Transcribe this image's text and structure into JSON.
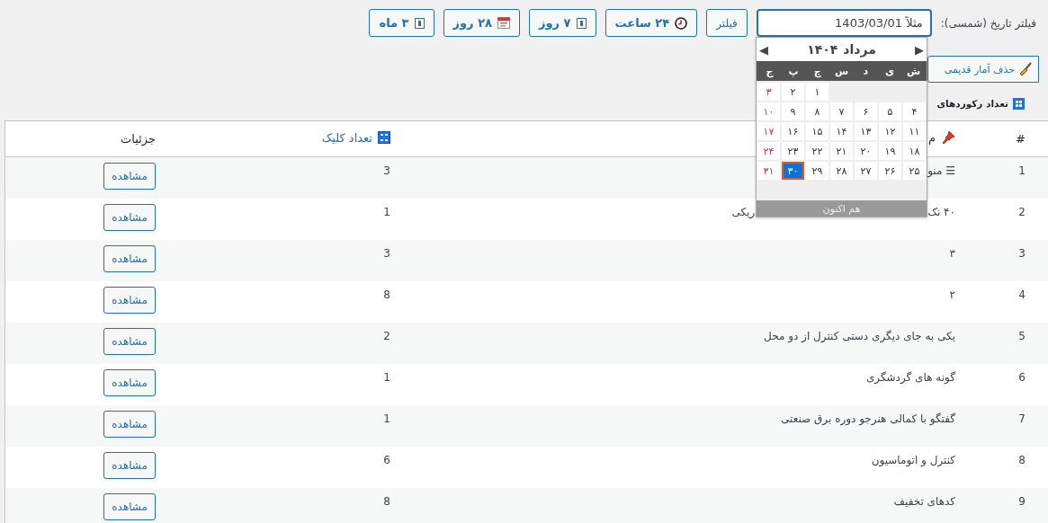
{
  "filter": {
    "label": "فیلتر تاریخ (شمسی):",
    "date_field": {
      "placeholder": "مثلاً 1403/03/01",
      "focused": true
    },
    "filter_button": "فیلتر",
    "range_buttons": [
      {
        "label": "۲۴ ساعت",
        "kind": "clock"
      },
      {
        "label": "۷ روز",
        "kind": "calendar"
      },
      {
        "label": "۲۸ روز",
        "kind": "calendar-page"
      },
      {
        "label": "۳ ماه",
        "kind": "calendar"
      }
    ]
  },
  "delete_button": "حذف آمار قدیمی",
  "section_title": "تعداد رکوردهای",
  "table": {
    "columns": [
      {
        "label": "#",
        "kind": "plain"
      },
      {
        "label": "م",
        "kind": "pin"
      },
      {
        "label": "تعداد کلیک",
        "kind": "link"
      },
      {
        "label": "جزئیات",
        "kind": "plain"
      }
    ],
    "rows": [
      {
        "index": "1",
        "title": "☰ منو",
        "clicks": "3",
        "action": "مشاهده"
      },
      {
        "index": "2",
        "title": "۴۰ نک",
        "title_after_overlay": "ریکی",
        "clicks": "1",
        "action": "مشاهده"
      },
      {
        "index": "3",
        "title": "۳",
        "clicks": "3",
        "action": "مشاهده"
      },
      {
        "index": "4",
        "title": "۲",
        "clicks": "8",
        "action": "مشاهده"
      },
      {
        "index": "5",
        "title": "یکی به جای دیگری دستی کنترل از دو محل",
        "clicks": "2",
        "action": "مشاهده"
      },
      {
        "index": "6",
        "title": "گونه های گردشگری",
        "clicks": "1",
        "action": "مشاهده"
      },
      {
        "index": "7",
        "title": "گفتگو با کمالی هنرجو دوره برق صنعتی",
        "clicks": "1",
        "action": "مشاهده"
      },
      {
        "index": "8",
        "title": "کنترل و اتوماسیون",
        "clicks": "6",
        "action": "مشاهده"
      },
      {
        "index": "9",
        "title": "کدهای تخفیف",
        "clicks": "8",
        "action": "مشاهده"
      }
    ]
  },
  "calendar": {
    "prev": "◀",
    "next": "▶",
    "month": "مرداد",
    "year": "۱۴۰۴",
    "weekdays": [
      "ش",
      "ی",
      "د",
      "س",
      "چ",
      "پ",
      "ج"
    ],
    "weeks": [
      [
        {
          "label": "۱",
          "holiday": false,
          "selected": false
        },
        {
          "label": "۲",
          "holiday": false,
          "selected": false
        },
        {
          "label": "۳",
          "holiday": true,
          "selected": false
        }
      ],
      [
        {
          "label": "۴",
          "holiday": false,
          "selected": false
        },
        {
          "label": "۵",
          "holiday": false,
          "selected": false
        },
        {
          "label": "۶",
          "holiday": false,
          "selected": false
        },
        {
          "label": "۷",
          "holiday": false,
          "selected": false
        },
        {
          "label": "۸",
          "holiday": false,
          "selected": false
        },
        {
          "label": "۹",
          "holiday": false,
          "selected": false
        },
        {
          "label": "۱۰",
          "holiday": true,
          "selected": false
        }
      ],
      [
        {
          "label": "۱۱",
          "holiday": false,
          "selected": false
        },
        {
          "label": "۱۲",
          "holiday": false,
          "selected": false
        },
        {
          "label": "۱۳",
          "holiday": false,
          "selected": false
        },
        {
          "label": "۱۴",
          "holiday": false,
          "selected": false
        },
        {
          "label": "۱۵",
          "holiday": false,
          "selected": false
        },
        {
          "label": "۱۶",
          "holiday": false,
          "selected": false
        },
        {
          "label": "۱۷",
          "holiday": true,
          "selected": false
        }
      ],
      [
        {
          "label": "۱۸",
          "holiday": false,
          "selected": false
        },
        {
          "label": "۱۹",
          "holiday": false,
          "selected": false
        },
        {
          "label": "۲۰",
          "holiday": false,
          "selected": false
        },
        {
          "label": "۲۱",
          "holiday": false,
          "selected": false
        },
        {
          "label": "۲۲",
          "holiday": false,
          "selected": false
        },
        {
          "label": "۲۳",
          "holiday": false,
          "selected": false
        },
        {
          "label": "۲۴",
          "holiday": true,
          "selected": false
        }
      ],
      [
        {
          "label": "۲۵",
          "holiday": false,
          "selected": false
        },
        {
          "label": "۲۶",
          "holiday": false,
          "selected": false
        },
        {
          "label": "۲۷",
          "holiday": false,
          "selected": false
        },
        {
          "label": "۲۸",
          "holiday": false,
          "selected": false
        },
        {
          "label": "۲۹",
          "holiday": false,
          "selected": false
        },
        {
          "label": "۳۰",
          "holiday": false,
          "selected": true
        },
        {
          "label": "۳۱",
          "holiday": true,
          "selected": false
        }
      ]
    ],
    "today_button": "هم اکنون"
  }
}
